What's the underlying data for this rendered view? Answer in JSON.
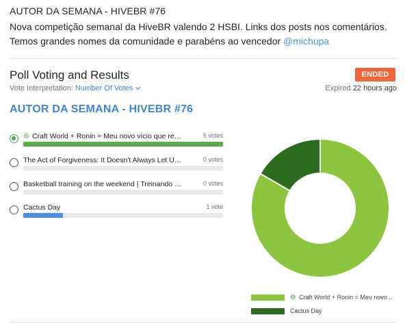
{
  "post": {
    "title": "AUTOR DA SEMANA - HIVEBR #76",
    "body_text": "Nova competição semanal da HiveBR valendo 2 HSBI. Links dos posts nos comentários. Temos grandes nomes da comunidade e parabéns ao vencedor ",
    "mention": "@michupa"
  },
  "poll": {
    "header": "Poll Voting and Results",
    "status_badge": "ENDED",
    "interpretation_label": "Vote Interpretation: ",
    "interpretation_value": "Number Of Votes",
    "expired_label": "Expired ",
    "expired_time": "22 hours ago",
    "question": "AUTOR DA SEMANA - HIVEBR #76",
    "options": [
      {
        "label": "Craft World + Ronin = Meu novo vício que rende",
        "votes_text": "5 votes",
        "votes": 5,
        "fraction": 1.0,
        "checked": true,
        "color": "#5cad4a",
        "icon": "gear-icon"
      },
      {
        "label": "The Act of Forgiveness: It Doesn't Always Let Us For...",
        "votes_text": "0 votes",
        "votes": 0,
        "fraction": 0.0,
        "checked": false,
        "color": "#5cad4a"
      },
      {
        "label": "Basketball training on the weekend | Treinando basq...",
        "votes_text": "0 votes",
        "votes": 0,
        "fraction": 0.0,
        "checked": false,
        "color": "#5cad4a"
      },
      {
        "label": "Cactus Day",
        "votes_text": "1 vote",
        "votes": 1,
        "fraction": 0.2,
        "checked": false,
        "color": "#4a90e2"
      }
    ]
  },
  "chart_data": {
    "type": "pie",
    "categories": [
      "Craft World + Ronin = Meu novo ..",
      "Cactus Day"
    ],
    "values": [
      5,
      1
    ],
    "colors": [
      "#8cc63e",
      "#2d6b1e"
    ],
    "legend_position": "bottom",
    "legend_icon": "gear-icon"
  }
}
